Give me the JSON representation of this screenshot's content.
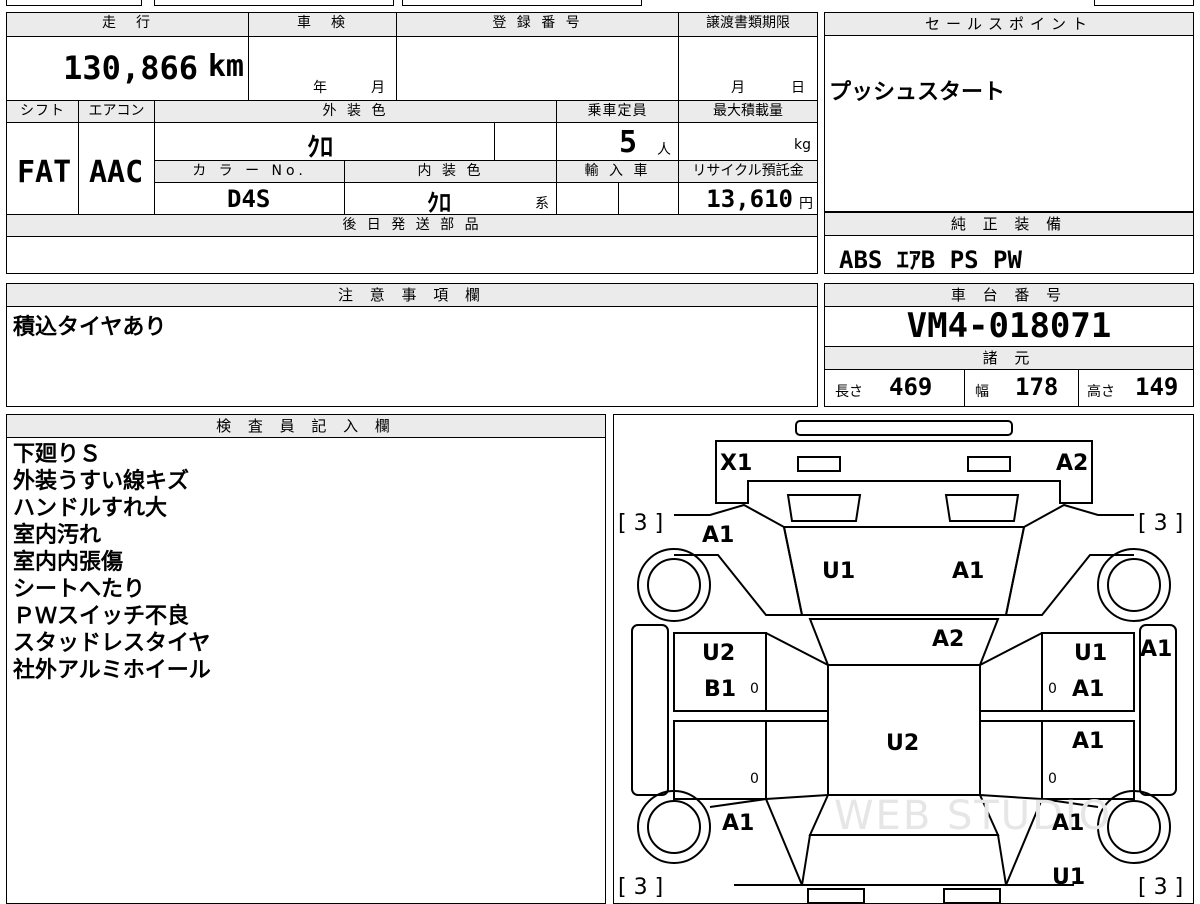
{
  "top_strip_partial": "",
  "main": {
    "mileage_label": "走　行",
    "mileage_value": "130,866",
    "mileage_unit": "km",
    "inspection_label": "車　検",
    "inspection_year": "年",
    "inspection_month": "月",
    "registration_label": "登 録 番 号",
    "transfer_label": "譲渡書類期限",
    "transfer_month": "月",
    "transfer_day": "日",
    "shift_label": "シフト",
    "shift_value": "FAT",
    "ac_label": "エアコン",
    "ac_value": "AAC",
    "exterior_color_label": "外 装 色",
    "exterior_color_value": "ｸﾛ",
    "capacity_label": "乗車定員",
    "capacity_value": "5",
    "capacity_unit": "人",
    "max_load_label": "最大積載量",
    "max_load_unit": "kg",
    "color_no_label": "カ ラ ー No.",
    "color_no_value": "D4S",
    "interior_color_label": "内 装 色",
    "interior_color_value": "ｸﾛ",
    "interior_color_suffix": "系",
    "import_label": "輸 入 車",
    "recycle_label": "リサイクル預託金",
    "recycle_value": "13,610",
    "recycle_unit": "円",
    "later_parts_label": "後 日 発 送 部 品",
    "later_parts_value": ""
  },
  "sales_point": {
    "label": "セールスポイント",
    "text": "プッシュスタート"
  },
  "equipment": {
    "label": "純 正 装 備",
    "text": "ABS ｴｱB PS PW"
  },
  "caution": {
    "label": "注 意 事 項 欄",
    "text": "積込タイヤあり"
  },
  "chassis": {
    "label": "車 台 番 号",
    "value": "VM4-018071"
  },
  "specs": {
    "label": "諸 元",
    "length_label": "長さ",
    "length_value": "469",
    "width_label": "幅",
    "width_value": "178",
    "height_label": "高さ",
    "height_value": "149"
  },
  "inspector": {
    "label": "検 査 員 記 入 欄",
    "lines": [
      "下廻りＳ",
      "外装うすい線キズ",
      "ハンドルすれ大",
      "室内汚れ",
      "室内内張傷",
      "シートへたり",
      "ＰＷスイッチ不良",
      "スタッドレスタイヤ",
      "社外アルミホイール"
    ]
  },
  "diagram": {
    "marks": {
      "front_left": "X1",
      "front_right": "A2",
      "tire_fl": "[ 3 ]",
      "tire_fr": "[ 3 ]",
      "tire_rl": "[ 3 ]",
      "tire_rr": "[ 3 ]",
      "fender_fl": "A1",
      "hood_left": "U1",
      "hood_right": "A1",
      "windshield": "A2",
      "door_fl_1": "U2",
      "door_fl_2": "B1",
      "door_fr_1": "U1",
      "door_fr_2": "A1",
      "right_side": "A1",
      "roof": "U2",
      "door_rr": "A1",
      "fender_rl": "A1",
      "fender_rr": "A1",
      "rear_right": "U1",
      "zero_1": "0",
      "zero_2": "0",
      "zero_3": "0",
      "zero_4": "0",
      "watermark": "WEB STUDIO"
    }
  }
}
